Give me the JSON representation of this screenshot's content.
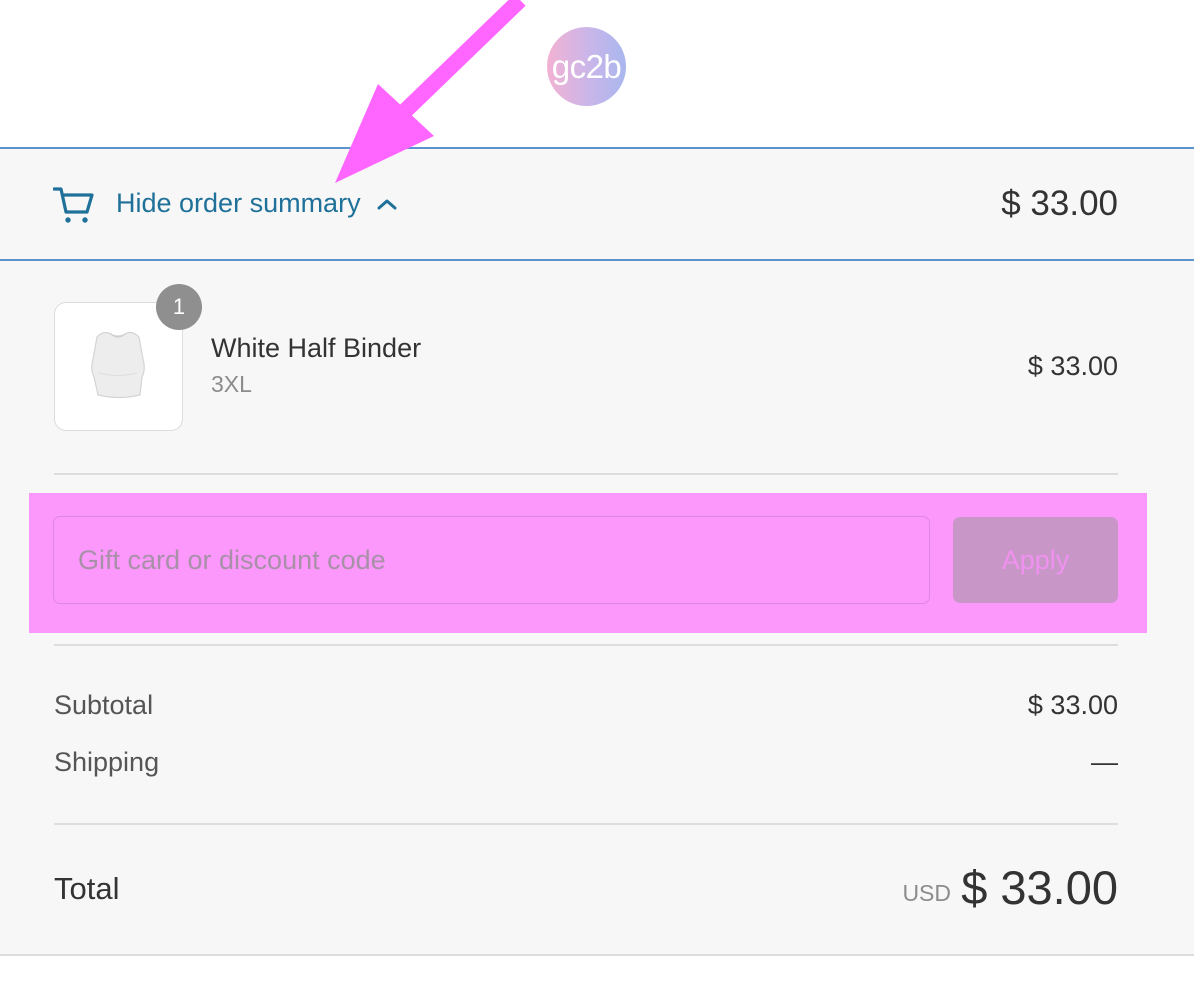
{
  "header": {
    "logo_text": "gc2b"
  },
  "summary_toggle": {
    "label": "Hide order summary",
    "total": "$ 33.00",
    "cart_icon": "shopping-cart-icon",
    "chevron_icon": "chevron-up-icon"
  },
  "line_items": [
    {
      "quantity": "1",
      "name": "White Half Binder",
      "variant": "3XL",
      "price": "$ 33.00"
    }
  ],
  "discount": {
    "placeholder": "Gift card or discount code",
    "value": "",
    "apply_label": "Apply",
    "highlight_color": "#fc98fc"
  },
  "totals": {
    "subtotal_label": "Subtotal",
    "subtotal_value": "$ 33.00",
    "shipping_label": "Shipping",
    "shipping_value": "—",
    "total_label": "Total",
    "currency": "USD",
    "total_value": "$ 33.00"
  },
  "colors": {
    "accent": "#1f7199",
    "border_blue": "#5b93cf",
    "annotation_magenta": "#ff66ff"
  }
}
